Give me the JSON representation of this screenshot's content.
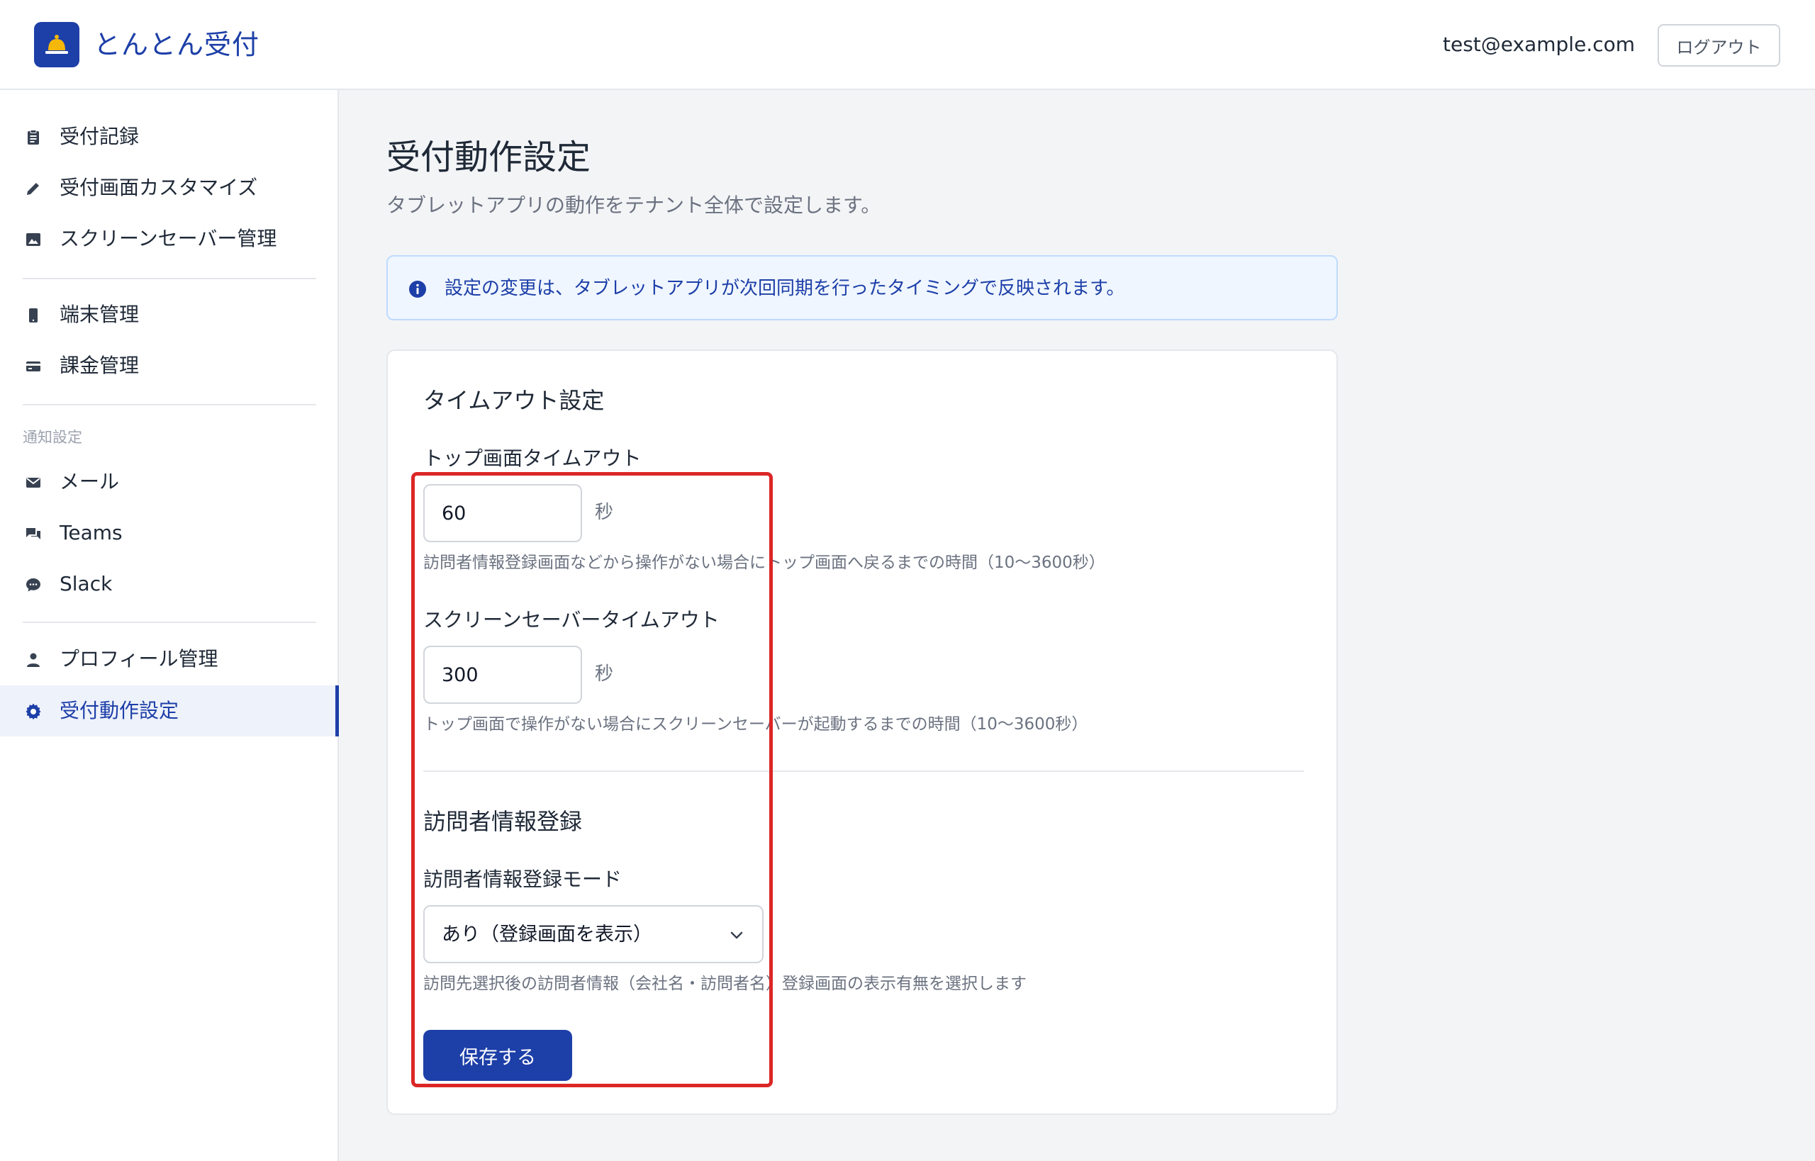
{
  "header": {
    "brand": "とんとん受付",
    "user_email": "test@example.com",
    "logout_label": "ログアウト",
    "accent_color": "#1d3fa8"
  },
  "sidebar": {
    "group1": [
      {
        "label": "受付記録",
        "icon": "clipboard-icon"
      },
      {
        "label": "受付画面カスタマイズ",
        "icon": "pencil-icon"
      },
      {
        "label": "スクリーンセーバー管理",
        "icon": "image-icon"
      }
    ],
    "group2": [
      {
        "label": "端末管理",
        "icon": "tablet-icon"
      },
      {
        "label": "課金管理",
        "icon": "credit-card-icon"
      }
    ],
    "notify_section_label": "通知設定",
    "group3": [
      {
        "label": "メール",
        "icon": "mail-icon"
      },
      {
        "label": "Teams",
        "icon": "chat-icon"
      },
      {
        "label": "Slack",
        "icon": "message-icon"
      }
    ],
    "group4": [
      {
        "label": "プロフィール管理",
        "icon": "person-icon"
      },
      {
        "label": "受付動作設定",
        "icon": "gear-icon",
        "active": true
      }
    ]
  },
  "main": {
    "title": "受付動作設定",
    "subtitle": "タブレットアプリの動作をテナント全体で設定します。",
    "info_text": "設定の変更は、タブレットアプリが次回同期を行ったタイミングで反映されます。",
    "timeout_section": {
      "title": "タイムアウト設定",
      "top_timeout": {
        "label": "トップ画面タイムアウト",
        "value": "60",
        "unit": "秒",
        "help": "訪問者情報登録画面などから操作がない場合にトップ画面へ戻るまでの時間（10〜3600秒）"
      },
      "screensaver_timeout": {
        "label": "スクリーンセーバータイムアウト",
        "value": "300",
        "unit": "秒",
        "help": "トップ画面で操作がない場合にスクリーンセーバーが起動するまでの時間（10〜3600秒）"
      }
    },
    "visitor_section": {
      "title": "訪問者情報登録",
      "mode_label": "訪問者情報登録モード",
      "mode_value": "あり（登録画面を表示）",
      "help": "訪問先選択後の訪問者情報（会社名・訪問者名）登録画面の表示有無を選択します"
    },
    "save_label": "保存する"
  }
}
